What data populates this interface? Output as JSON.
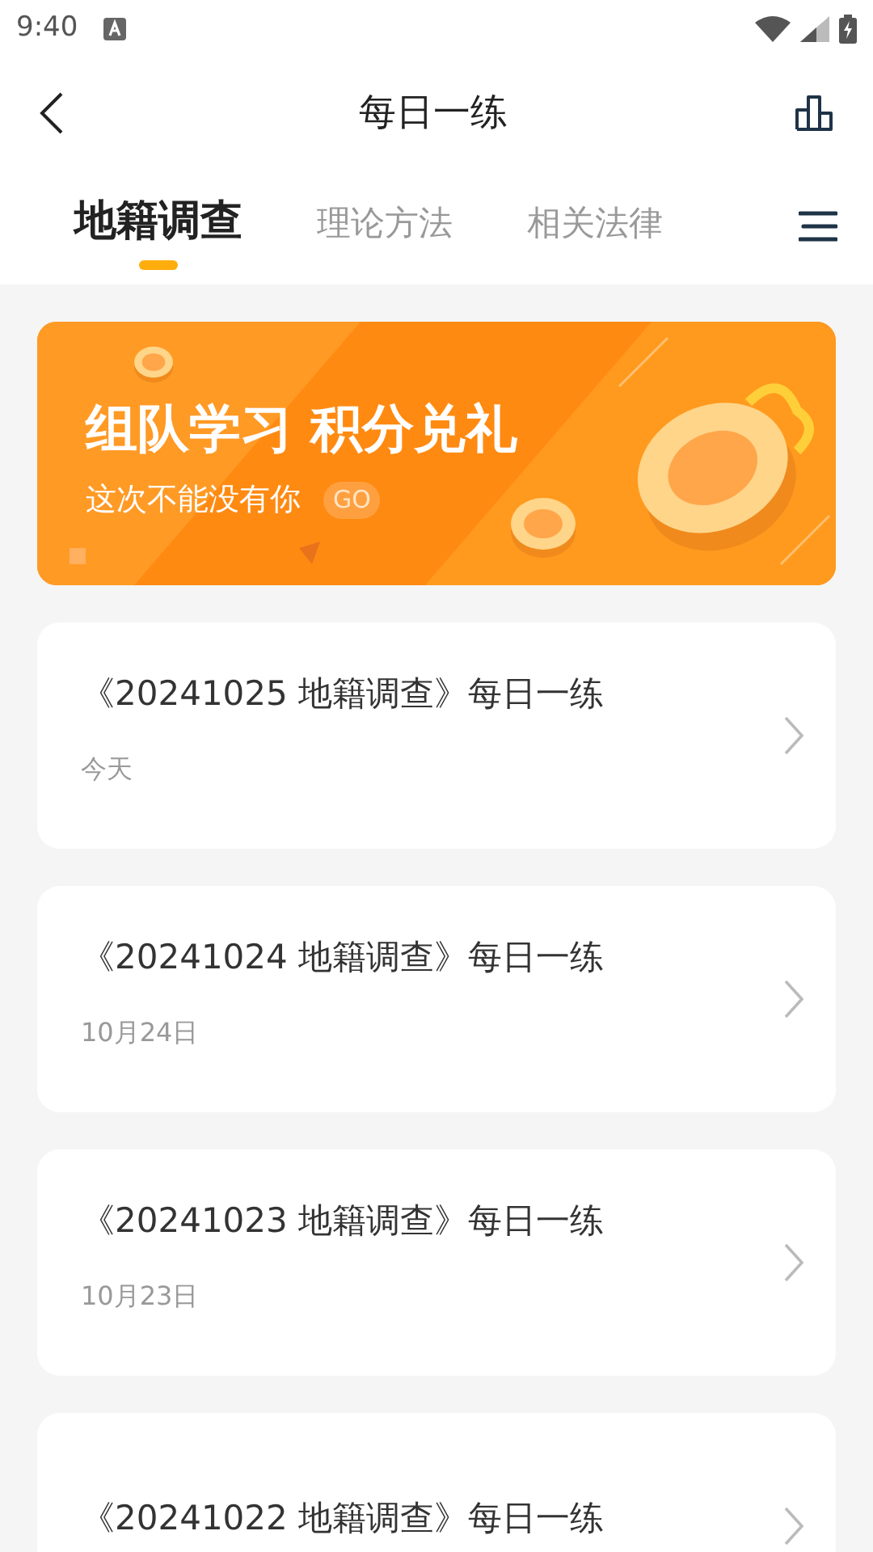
{
  "status_bar": {
    "time": "9:40"
  },
  "header": {
    "title": "每日一练"
  },
  "tabs": [
    {
      "label": "地籍调查",
      "selected": true
    },
    {
      "label": "理论方法",
      "selected": false
    },
    {
      "label": "相关法律",
      "selected": false
    }
  ],
  "banner": {
    "headline": "组队学习 积分兑礼",
    "subline": "这次不能没有你",
    "go": "GO"
  },
  "exercises": [
    {
      "title": "《20241025 地籍调查》每日一练",
      "date": "今天"
    },
    {
      "title": "《20241024 地籍调查》每日一练",
      "date": "10月24日"
    },
    {
      "title": "《20241023 地籍调查》每日一练",
      "date": "10月23日"
    },
    {
      "title": "《20241022 地籍调查》每日一练"
    }
  ]
}
